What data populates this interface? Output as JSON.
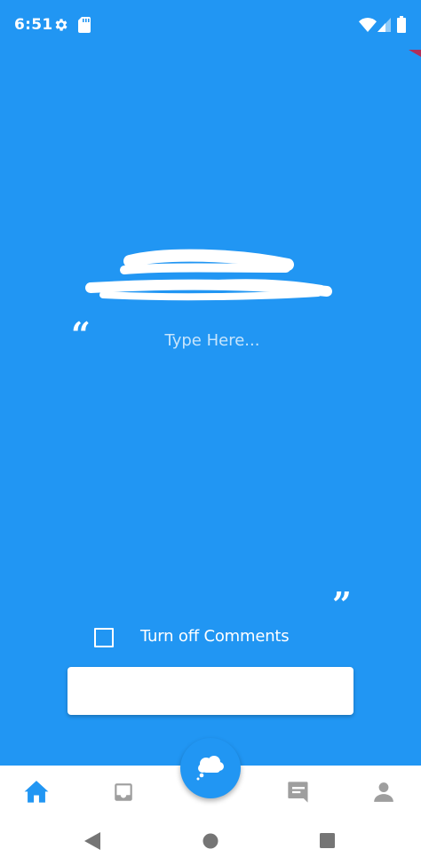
{
  "status_bar": {
    "time": "6:51",
    "icons": [
      "settings-icon",
      "sd-card-icon",
      "wifi-icon",
      "cell-signal-icon",
      "battery-icon"
    ]
  },
  "composer": {
    "placeholder": "Type Here...",
    "value": "",
    "open_quote": "“",
    "close_quote": "”"
  },
  "comments_option": {
    "label": "Turn off Comments",
    "checked": false
  },
  "submit": {
    "label": ""
  },
  "bottom_nav": {
    "items": [
      "home-icon",
      "inbox-icon",
      "thought-bubble-icon",
      "chat-icon",
      "profile-icon"
    ],
    "active": "home-icon"
  },
  "colors": {
    "primary": "#2196F3",
    "inactive_icon": "#9E9E9E",
    "surface": "#FFFFFF",
    "system_nav_icon": "#757575"
  }
}
